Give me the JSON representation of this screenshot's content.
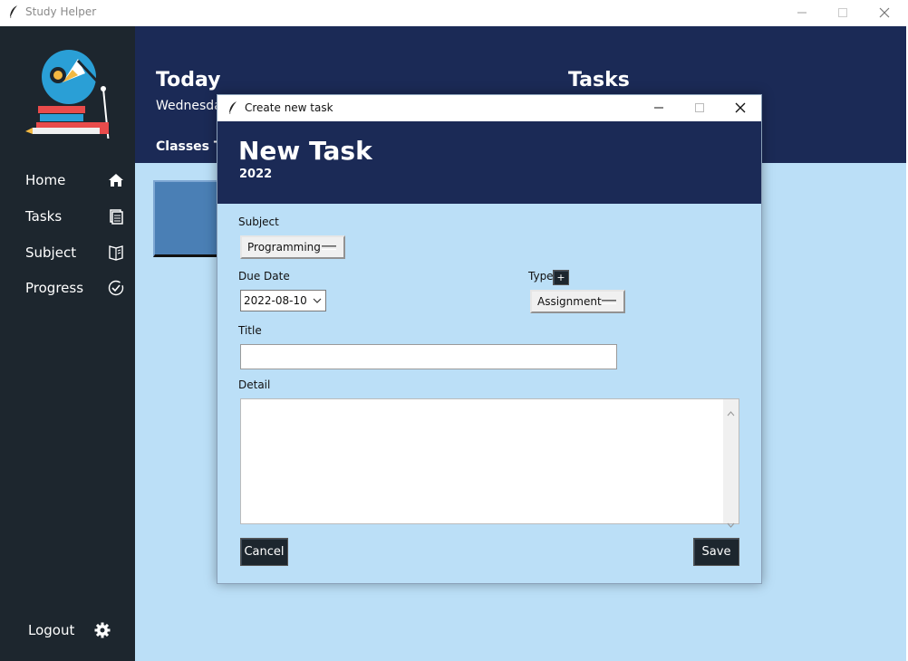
{
  "app": {
    "title": "Study Helper"
  },
  "sidebar": {
    "items": [
      {
        "label": "Home",
        "icon": "home-icon"
      },
      {
        "label": "Tasks",
        "icon": "tasks-icon"
      },
      {
        "label": "Subject",
        "icon": "book-icon"
      },
      {
        "label": "Progress",
        "icon": "check-circle-icon"
      }
    ],
    "logout_label": "Logout",
    "settings_icon": "gear-icon"
  },
  "header": {
    "today_title": "Today",
    "date_text": "Wednesda",
    "tasks_title": "Tasks",
    "classes_label": "Classes To"
  },
  "dialog": {
    "window_title": "Create new task",
    "heading": "New Task",
    "year": "2022",
    "subject_label": "Subject",
    "subject_value": "Programming",
    "due_date_label": "Due Date",
    "due_date_value": "2022-08-10",
    "type_label": "Type",
    "type_add_label": "+",
    "type_value": "Assignment",
    "title_label": "Title",
    "title_value": "",
    "detail_label": "Detail",
    "detail_value": "",
    "cancel_label": "Cancel",
    "save_label": "Save"
  },
  "colors": {
    "sidebar_bg": "#1d262e",
    "header_bg": "#1b2a56",
    "content_bg": "#bbdff7",
    "card_bg": "#4a7fb5"
  }
}
